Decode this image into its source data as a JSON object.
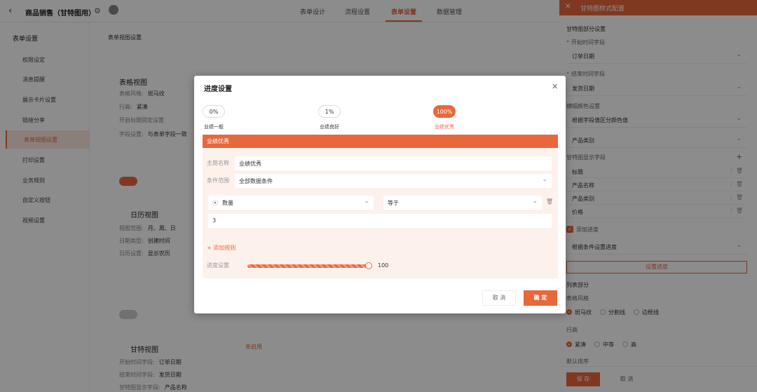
{
  "app": {
    "title": "商品销售（甘特图用）"
  },
  "tabs": [
    "表单设计",
    "流程设置",
    "表单设置",
    "数据管理"
  ],
  "sidebar": {
    "header": "表单设置",
    "items": [
      "权限设定",
      "消息提醒",
      "展示卡片设置",
      "链接分享",
      "表单视图设置",
      "打印设置",
      "业务规则",
      "自定义按钮",
      "视频设置"
    ],
    "active_index": 4
  },
  "content": {
    "breadcrumb": "表单视图设置",
    "table_view": {
      "title": "表格视图",
      "rows": [
        {
          "label": "表格风格:",
          "value": "斑马纹"
        },
        {
          "label": "行高:",
          "value": "紧凑"
        },
        {
          "label": "开启标题固定设置",
          "value": ""
        },
        {
          "label": "字段设置:",
          "value": "与表单字段一致"
        }
      ]
    },
    "calendar_view": {
      "title": "日历视图",
      "rows": [
        {
          "label": "视图范围:",
          "value": "月、周、日"
        },
        {
          "label": "日期类型:",
          "value": "创建时间"
        },
        {
          "label": "日历设置:",
          "value": "显示农历"
        }
      ]
    },
    "gantt_view": {
      "title": "甘特视图",
      "badge": "未启用",
      "rows": [
        {
          "label": "开始时间字段:",
          "value": "订单日期"
        },
        {
          "label": "结束时间字段:",
          "value": "发货日期"
        },
        {
          "label": "甘特图显示字段:",
          "value": "产品名称"
        }
      ]
    }
  },
  "right_panel": {
    "title": "甘特图样式配置",
    "section_gantt": "甘特图部分设置",
    "start_label": "开始时间字段",
    "start_value": "订单日期",
    "end_label": "结束时间字段",
    "end_value": "发货日期",
    "color_label": "横幅颜色设置",
    "color_mode": "根据字段值区分颜色值",
    "color_field": "产品类别",
    "display_label": "甘特图显示字段",
    "display_fields": [
      "标题",
      "产品名称",
      "产品类别",
      "价格"
    ],
    "progress_check_label": "添加进度",
    "progress_mode": "根据条件设置进度",
    "progress_button": "设置进度",
    "section_list": "列表部分",
    "table_style_label": "表格风格",
    "table_styles": [
      "斑马纹",
      "分割线",
      "边框线"
    ],
    "row_height_label": "行高",
    "row_heights": [
      "紧凑",
      "中等",
      "高"
    ],
    "sort_label": "默认排序",
    "save": "保 存",
    "cancel": "取 消"
  },
  "modal": {
    "title": "进度设置",
    "steps": [
      {
        "pct": "0%",
        "label": "业绩一般"
      },
      {
        "pct": "1%",
        "label": "业绩良好"
      },
      {
        "pct": "100%",
        "label": "业绩优秀"
      }
    ],
    "active_step": 2,
    "bar_title": "业绩优秀",
    "name_label": "主题名称",
    "name_value": "业绩优秀",
    "range_label": "条件范围",
    "range_value": "全部数据条件",
    "cond_field": "数量",
    "cond_op": "等于",
    "cond_value": "3",
    "add_rule": "添加规则",
    "progress_label": "进度设置",
    "progress_value": 100,
    "cancel": "取 消",
    "ok": "确 定"
  },
  "colors": {
    "accent": "#e8683c"
  }
}
